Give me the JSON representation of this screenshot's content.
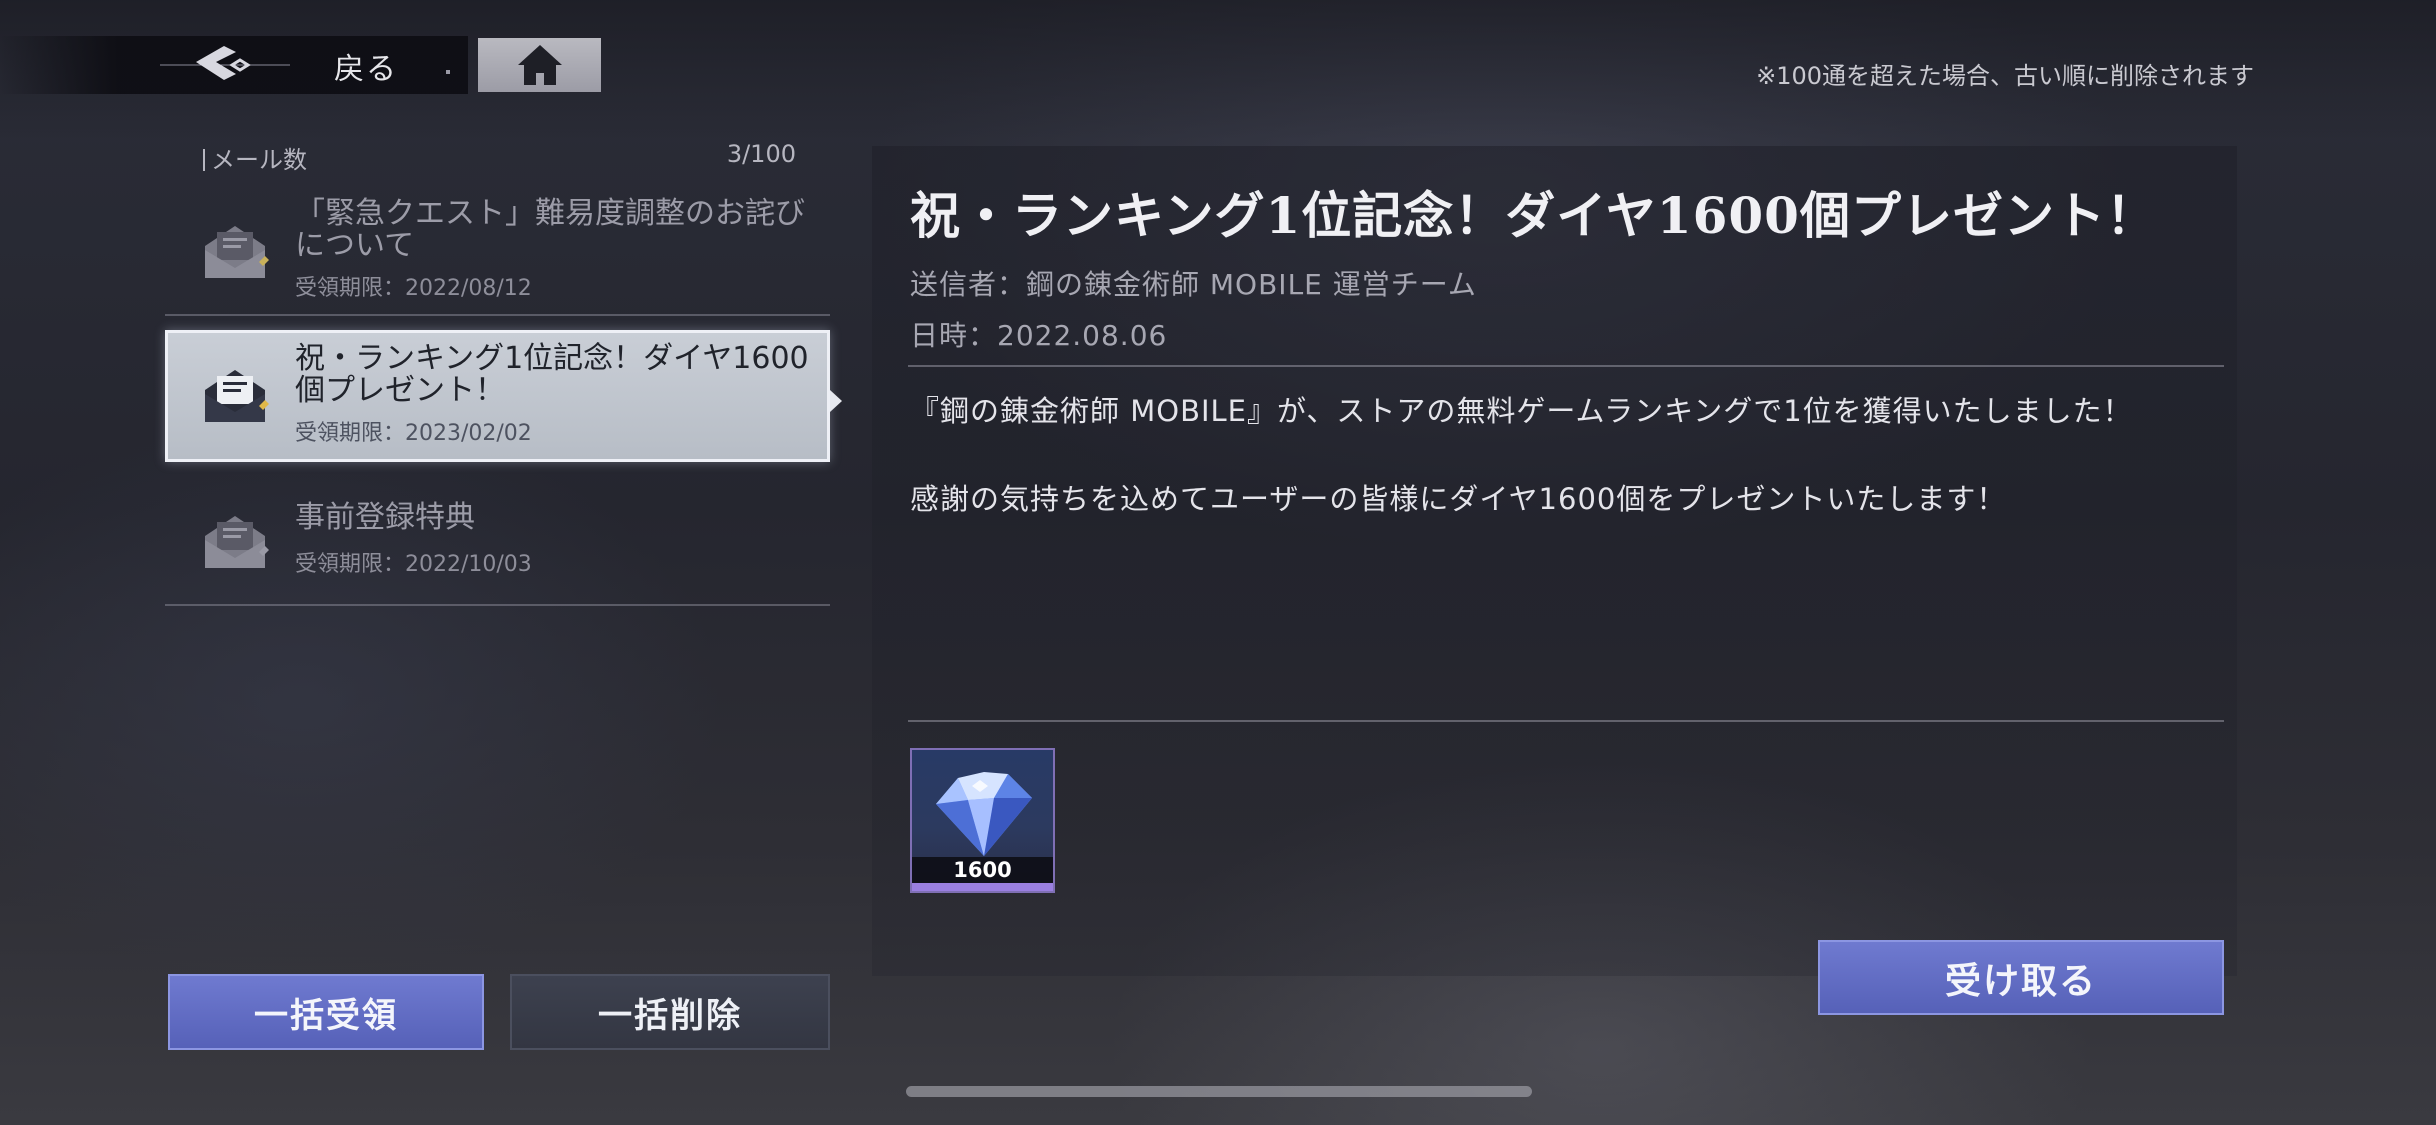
{
  "topbar": {
    "back_label": "戻る",
    "back_icon": "back-arrow-icon",
    "home_icon": "home-icon",
    "notice": "※100通を超えた場合、古い順に削除されます"
  },
  "mail_list": {
    "count_label": "メール数",
    "count_value": "3/100",
    "items": [
      {
        "title": "「緊急クエスト」難易度調整のお詫びについて",
        "expiry": "受領期限：2022/08/12",
        "icon": "mail-attachment-icon",
        "selected": false
      },
      {
        "title": "祝・ランキング1位記念！ダイヤ1600個プレゼント！",
        "expiry": "受領期限：2023/02/02",
        "icon": "mail-attachment-icon",
        "selected": true
      },
      {
        "title": "事前登録特典",
        "expiry": "受領期限：2022/10/03",
        "icon": "mail-attachment-icon",
        "selected": false
      }
    ],
    "claim_all_label": "一括受領",
    "delete_all_label": "一括削除"
  },
  "detail": {
    "title": "祝・ランキング1位記念！ダイヤ1600個プレゼント！",
    "sender": "送信者：鋼の錬金術師 MOBILE 運営チーム",
    "date": "日時：2022.08.06",
    "body_1": "『鋼の錬金術師 MOBILE』が、ストアの無料ゲームランキングで1位を獲得いたしました！",
    "body_2": "感謝の気持ちを込めてユーザーの皆様にダイヤ1600個をプレゼントいたします！",
    "reward": {
      "icon": "diamond-icon",
      "count": "1600"
    },
    "receive_label": "受け取る"
  },
  "colors": {
    "accent_button": "#5f6ac4",
    "selected_item": "#c3c8d0",
    "reward_rarity": "#9a7fe0"
  }
}
